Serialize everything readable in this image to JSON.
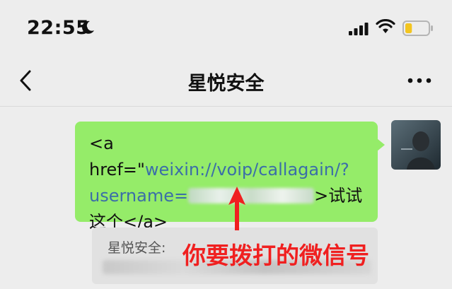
{
  "status_bar": {
    "time": "22:55",
    "battery_level": 0.3,
    "battery_color": "#f3c520"
  },
  "nav": {
    "title": "星悦安全"
  },
  "message": {
    "text_before": "<a href=\"",
    "link": "weixin://voip/callagain/?username=",
    "text_after": ">试试这个</a>",
    "bubble_color": "#95ec69",
    "link_color": "#3b6ea8"
  },
  "quote": {
    "sender": "星悦安全:"
  },
  "annotation": {
    "text": "你要拨打的微信号",
    "color": "#f02020"
  }
}
